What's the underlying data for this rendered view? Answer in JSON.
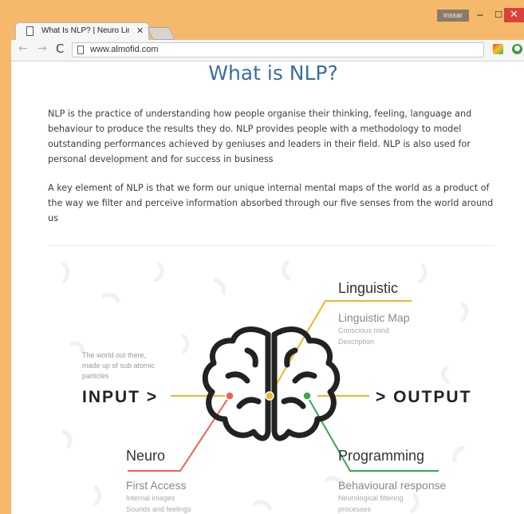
{
  "browser": {
    "user": "inssar",
    "window_buttons": {
      "minimize": "‒",
      "maximize": "☐",
      "close": "✕"
    },
    "tab": {
      "title": "What Is NLP? | Neuro Lin",
      "close": "✕"
    },
    "nav": {
      "back": "←",
      "forward": "→",
      "reload": "C"
    },
    "url": "www.almofid.com",
    "ext2_glyph": "●"
  },
  "page": {
    "title": "What is NLP?",
    "paragraphs": [
      "NLP is the practice of understanding how people organise their thinking, feeling, language and behaviour to produce the results they do. NLP provides people with a methodology to model outstanding performances achieved by geniuses and leaders in their field. NLP is also used for personal development and for success in business",
      "A key element of NLP is that we form our unique internal mental maps of the world as a product of the way we filter and perceive information absorbed through our five senses from the world around us"
    ]
  },
  "diagram": {
    "input_label": "INPUT >",
    "output_label": "> OUTPUT",
    "input_note": [
      "The world out there,",
      "made up of sub atomic",
      "particles"
    ],
    "linguistic": {
      "title": "Linguistic",
      "subtitle": "Linguistic Map",
      "notes": [
        "Conscious mind",
        "Description"
      ]
    },
    "neuro": {
      "title": "Neuro",
      "subtitle": "First Access",
      "notes": [
        "Internal images",
        "Sounds and feelings"
      ]
    },
    "programming": {
      "title": "Programming",
      "subtitle": "Behavioural response",
      "notes": [
        "Neurological filtering",
        "processes"
      ]
    },
    "colors": {
      "linguistic": "#f0b42e",
      "neuro": "#ec6450",
      "programming": "#34a853",
      "text_dark": "#333333",
      "text_grey": "#9a9a9a",
      "brain": "#222222",
      "pattern": "#f3f3f3"
    }
  }
}
